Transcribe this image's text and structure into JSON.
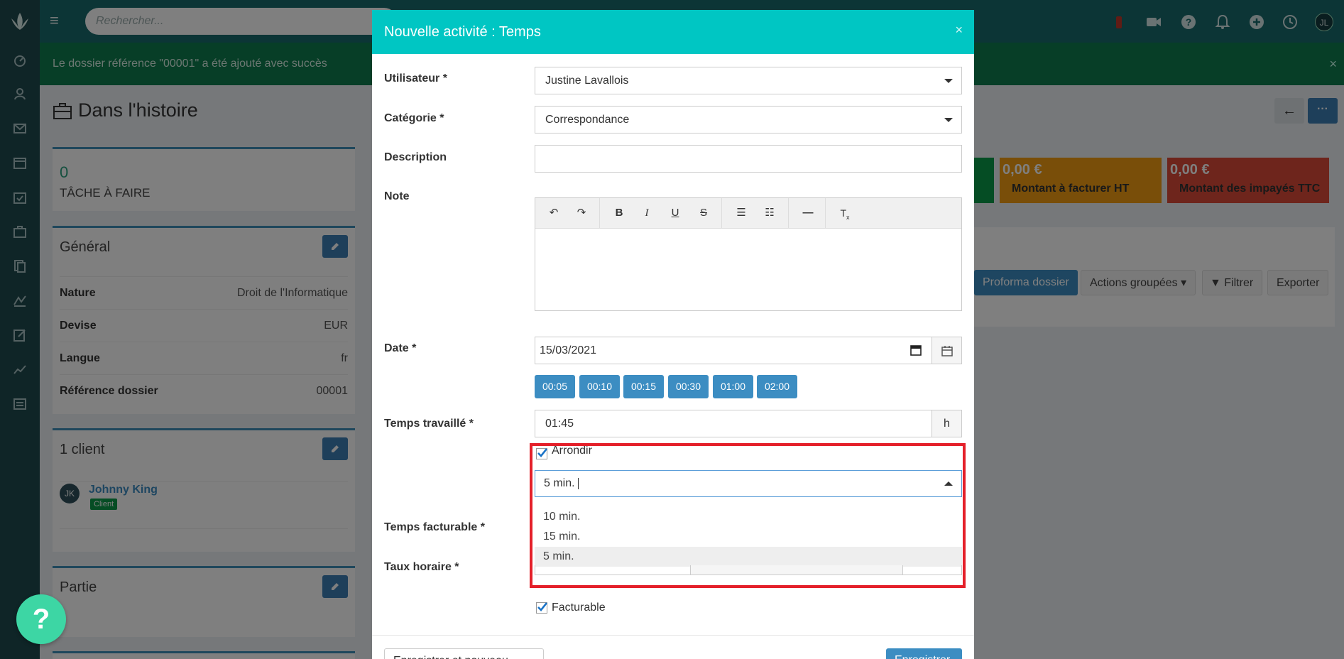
{
  "topbar": {
    "search_placeholder": "Rechercher...",
    "avatar_initials": "JL"
  },
  "alert": {
    "message": "Le dossier référence \"00001\" a été ajouté avec succès"
  },
  "page": {
    "title": "Dans l'histoire"
  },
  "stats": {
    "tasks_count": "0",
    "tasks_label": "TÂCHE À FAIRE",
    "billable_amount": "0,00 €",
    "billable_label": "Montant à facturer HT",
    "unpaid_amount": "0,00 €",
    "unpaid_label": "Montant des impayés TTC"
  },
  "general": {
    "title": "Général",
    "rows": [
      {
        "key": "Nature",
        "value": "Droit de l'Informatique"
      },
      {
        "key": "Devise",
        "value": "EUR"
      },
      {
        "key": "Langue",
        "value": "fr"
      },
      {
        "key": "Référence dossier",
        "value": "00001"
      }
    ]
  },
  "clients": {
    "title": "1 client",
    "client_initials": "JK",
    "client_name": "Johnny King",
    "client_badge": "Client"
  },
  "party": {
    "title": "Partie"
  },
  "toolbar_bg": {
    "proforma": "Proforma dossier",
    "grouped": "Actions groupées ▾",
    "filter": "Filtrer",
    "export": "Exporter"
  },
  "help": {
    "label": "?"
  },
  "modal": {
    "title": "Nouvelle activité : Temps",
    "close": "×",
    "user_label": "Utilisateur *",
    "user_value": "Justine Lavallois",
    "category_label": "Catégorie *",
    "category_value": "Correspondance",
    "description_label": "Description",
    "description_value": "",
    "note_label": "Note",
    "date_label": "Date *",
    "date_value": "15/03/2021",
    "quick_times": [
      "00:05",
      "00:10",
      "00:15",
      "00:30",
      "01:00",
      "02:00"
    ],
    "worked_label": "Temps travaillé *",
    "worked_value": "01:45",
    "worked_unit": "h",
    "round_label": "Arrondir",
    "round_checked": true,
    "round_select_value": "5 min.",
    "round_options": [
      "10 min.",
      "15 min.",
      "5 min."
    ],
    "round_selected_option": "5 min.",
    "billed_label": "Temps facturable *",
    "rate_label": "Taux horaire *",
    "billable_label": "Facturable",
    "billable_checked": true,
    "save_new_label": "Enregistrer et nouveau",
    "save_label": "Enregistrer"
  },
  "colors": {
    "modal_header": "#00c6c3",
    "primary": "#3c8dc2",
    "highlight": "#e4202a",
    "alert_green": "#0e7d4e",
    "stat_green": "#0b9a49",
    "stat_orange": "#f39c12",
    "stat_red": "#dd4b39"
  }
}
